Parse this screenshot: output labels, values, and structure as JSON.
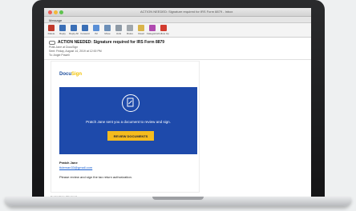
{
  "window": {
    "title": "ACTION NEEDED: Signature required for IRS Form 8879 - Inbox"
  },
  "message_tab": "Message",
  "ribbon": {
    "buttons": [
      {
        "label": "Delete",
        "icon": "trash-icon",
        "color": "#c0392b"
      },
      {
        "label": "Reply",
        "icon": "reply-icon",
        "color": "#3b6fb6"
      },
      {
        "label": "Reply All",
        "icon": "reply-all-icon",
        "color": "#3b6fb6"
      },
      {
        "label": "Forward",
        "icon": "forward-icon",
        "color": "#3b6fb6"
      },
      {
        "label": "IM",
        "icon": "chat-icon",
        "color": "#5a8fd6"
      },
      {
        "label": "Move",
        "icon": "move-icon",
        "color": "#6c8fb8"
      },
      {
        "label": "Junk",
        "icon": "junk-icon",
        "color": "#8e9aa6"
      },
      {
        "label": "Rules",
        "icon": "rules-icon",
        "color": "#a0a7ad"
      },
      {
        "label": "Read",
        "icon": "envelope-icon",
        "color": "#d9b44a"
      },
      {
        "label": "Categorize",
        "icon": "categorize-icon",
        "color": "#b04ab0"
      },
      {
        "label": "Follow Up",
        "icon": "flag-icon",
        "color": "#d23b2f"
      }
    ]
  },
  "header": {
    "subject": "ACTION NEEDED: Signature required for IRS Form 8879",
    "from": "Pratt-Jane at DocuSign",
    "sent": "Sent: Friday, August 14, 2019 at 12:00 PM",
    "to": "To: Angie Powell"
  },
  "email": {
    "logo_main": "Docu",
    "logo_accent": "Sign",
    "banner_text": "Pratch Jane sent you a document to review and sign.",
    "review_button": "REVIEW DOCUMENTS",
    "sender_name": "Pratch Jane",
    "sender_email": "ttdeman33@gmail.com",
    "body_text": "Please review and sign the tax return authorization.",
    "footer": "Do Not Share This Email"
  },
  "colors": {
    "banner": "#1e4aab",
    "button": "#f5bb1e"
  }
}
